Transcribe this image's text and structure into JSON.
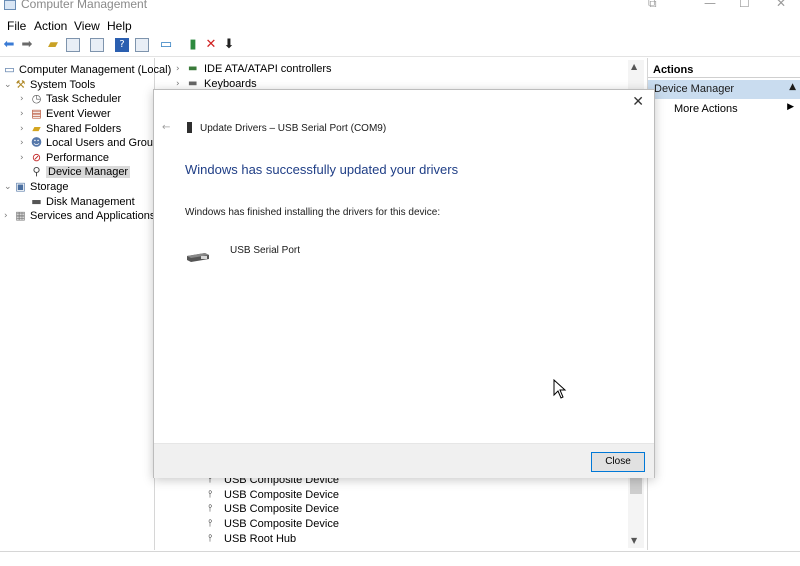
{
  "window": {
    "title": "Computer Management",
    "controls": {
      "restore": "⧉",
      "minimize": "—",
      "maximize": "☐",
      "close": "✕"
    }
  },
  "menubar": [
    "File",
    "Action",
    "View",
    "Help"
  ],
  "tree": {
    "items": [
      {
        "label": "Computer Management (Local)",
        "icon": "computer-icon",
        "arrow": ""
      },
      {
        "label": "System Tools",
        "icon": "tools-icon",
        "arrow": "v"
      },
      {
        "label": "Task Scheduler",
        "icon": "clock-icon",
        "arrow": ">"
      },
      {
        "label": "Event Viewer",
        "icon": "event-icon",
        "arrow": ">"
      },
      {
        "label": "Shared Folders",
        "icon": "folder-icon",
        "arrow": ">"
      },
      {
        "label": "Local Users and Groups",
        "icon": "users-icon",
        "arrow": ">"
      },
      {
        "label": "Performance",
        "icon": "performance-icon",
        "arrow": ">"
      },
      {
        "label": "Device Manager",
        "icon": "device-manager-icon",
        "arrow": ""
      },
      {
        "label": "Storage",
        "icon": "storage-icon",
        "arrow": "v"
      },
      {
        "label": "Disk Management",
        "icon": "disk-icon",
        "arrow": ""
      },
      {
        "label": "Services and Applications",
        "icon": "services-icon",
        "arrow": ">"
      }
    ]
  },
  "devices": {
    "top": [
      {
        "label": "IDE ATA/ATAPI controllers",
        "icon": "controller-icon"
      },
      {
        "label": "Keyboards",
        "icon": "keyboard-icon"
      }
    ],
    "bottom": [
      {
        "label": "USB Composite Device",
        "icon": "usb-icon"
      },
      {
        "label": "USB Composite Device",
        "icon": "usb-icon"
      },
      {
        "label": "USB Composite Device",
        "icon": "usb-icon"
      },
      {
        "label": "USB Composite Device",
        "icon": "usb-icon"
      },
      {
        "label": "USB Root Hub",
        "icon": "usb-icon"
      }
    ]
  },
  "actions": {
    "header": "Actions",
    "section": "Device Manager",
    "item": "More Actions"
  },
  "dialog": {
    "title": "Update Drivers – USB Serial Port (COM9)",
    "heading": "Windows has successfully updated your drivers",
    "message": "Windows has finished installing the drivers for this device:",
    "device": "USB Serial Port",
    "close_button": "Close",
    "close_x": "✕",
    "back_arrow": "←"
  },
  "colors": {
    "accent": "#1f3e86",
    "selection": "#c9dcef",
    "button_border": "#0078d7"
  }
}
